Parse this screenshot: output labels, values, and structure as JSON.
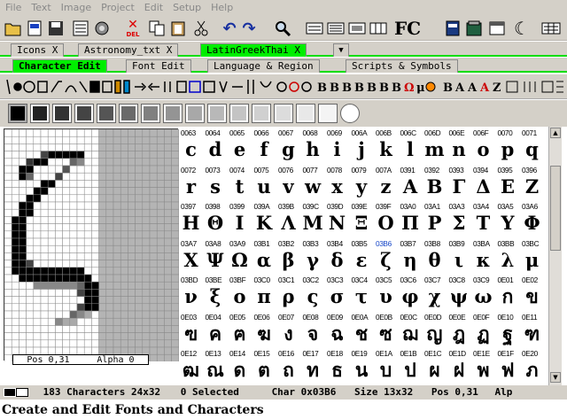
{
  "menu": [
    "File",
    "Text",
    "Image",
    "Project",
    "Edit",
    "Setup",
    "Help"
  ],
  "toolbar": {
    "del_label": "DEL",
    "fc_label": "FC"
  },
  "tabs": [
    {
      "label": "Icons",
      "close": "X",
      "active": false
    },
    {
      "label": "Astronomy_txt",
      "close": "X",
      "active": false
    },
    {
      "label": "LatinGreekThai",
      "close": "X",
      "active": true
    }
  ],
  "subtabs": [
    {
      "label": "Character Edit",
      "active": true
    },
    {
      "label": "Font Edit",
      "active": false
    },
    {
      "label": "Language & Region",
      "active": false
    },
    {
      "label": "Scripts & Symbols",
      "active": false
    }
  ],
  "editor": {
    "pos": "Pos 0,31",
    "alpha": "Alpha 0"
  },
  "selected_code": "03B6",
  "rows": [
    {
      "codes": [
        "0063",
        "0064",
        "0065",
        "0066",
        "0067",
        "0068",
        "0069",
        "006A",
        "006B",
        "006C",
        "006D",
        "006E",
        "006F",
        "0070",
        "0071"
      ],
      "glyphs": [
        "c",
        "d",
        "e",
        "f",
        "g",
        "h",
        "i",
        "j",
        "k",
        "l",
        "m",
        "n",
        "o",
        "p",
        "q"
      ]
    },
    {
      "codes": [
        "0072",
        "0073",
        "0074",
        "0075",
        "0076",
        "0077",
        "0078",
        "0079",
        "007A",
        "0391",
        "0392",
        "0393",
        "0394",
        "0395",
        "0396"
      ],
      "glyphs": [
        "r",
        "s",
        "t",
        "u",
        "v",
        "w",
        "x",
        "y",
        "z",
        "Α",
        "Β",
        "Γ",
        "Δ",
        "Ε",
        "Ζ"
      ]
    },
    {
      "codes": [
        "0397",
        "0398",
        "0399",
        "039A",
        "039B",
        "039C",
        "039D",
        "039E",
        "039F",
        "03A0",
        "03A1",
        "03A3",
        "03A4",
        "03A5",
        "03A6"
      ],
      "glyphs": [
        "Η",
        "Θ",
        "Ι",
        "Κ",
        "Λ",
        "Μ",
        "Ν",
        "Ξ",
        "Ο",
        "Π",
        "Ρ",
        "Σ",
        "Τ",
        "Υ",
        "Φ"
      ]
    },
    {
      "codes": [
        "03A7",
        "03A8",
        "03A9",
        "03B1",
        "03B2",
        "03B3",
        "03B4",
        "03B5",
        "03B6",
        "03B7",
        "03B8",
        "03B9",
        "03BA",
        "03BB",
        "03BC"
      ],
      "glyphs": [
        "Χ",
        "Ψ",
        "Ω",
        "α",
        "β",
        "γ",
        "δ",
        "ε",
        "ζ",
        "η",
        "θ",
        "ι",
        "κ",
        "λ",
        "μ"
      ]
    },
    {
      "codes": [
        "03BD",
        "03BE",
        "03BF",
        "03C0",
        "03C1",
        "03C2",
        "03C3",
        "03C4",
        "03C5",
        "03C6",
        "03C7",
        "03C8",
        "03C9",
        "0E01",
        "0E02"
      ],
      "glyphs": [
        "ν",
        "ξ",
        "ο",
        "π",
        "ρ",
        "ς",
        "σ",
        "τ",
        "υ",
        "φ",
        "χ",
        "ψ",
        "ω",
        "ก",
        "ข"
      ]
    },
    {
      "codes": [
        "0E03",
        "0E04",
        "0E05",
        "0E06",
        "0E07",
        "0E08",
        "0E09",
        "0E0A",
        "0E0B",
        "0E0C",
        "0E0D",
        "0E0E",
        "0E0F",
        "0E10",
        "0E11"
      ],
      "glyphs": [
        "ฃ",
        "ค",
        "ฅ",
        "ฆ",
        "ง",
        "จ",
        "ฉ",
        "ช",
        "ซ",
        "ฌ",
        "ญ",
        "ฎ",
        "ฏ",
        "ฐ",
        "ฑ"
      ]
    },
    {
      "codes": [
        "0E12",
        "0E13",
        "0E14",
        "0E15",
        "0E16",
        "0E17",
        "0E18",
        "0E19",
        "0E1A",
        "0E1B",
        "0E1C",
        "0E1D",
        "0E1E",
        "0E1F",
        "0E20"
      ],
      "glyphs": [
        "ฒ",
        "ณ",
        "ด",
        "ต",
        "ถ",
        "ท",
        "ธ",
        "น",
        "บ",
        "ป",
        "ผ",
        "ฝ",
        "พ",
        "ฟ",
        "ภ"
      ]
    }
  ],
  "status": {
    "count": "183 Characters 24x32",
    "selected": "0 Selected",
    "char": "Char 0x03B6",
    "size": "Size 13x32",
    "pos": "Pos 0,31",
    "alpha": "Alp"
  },
  "caption": "Create and Edit Fonts and Characters"
}
